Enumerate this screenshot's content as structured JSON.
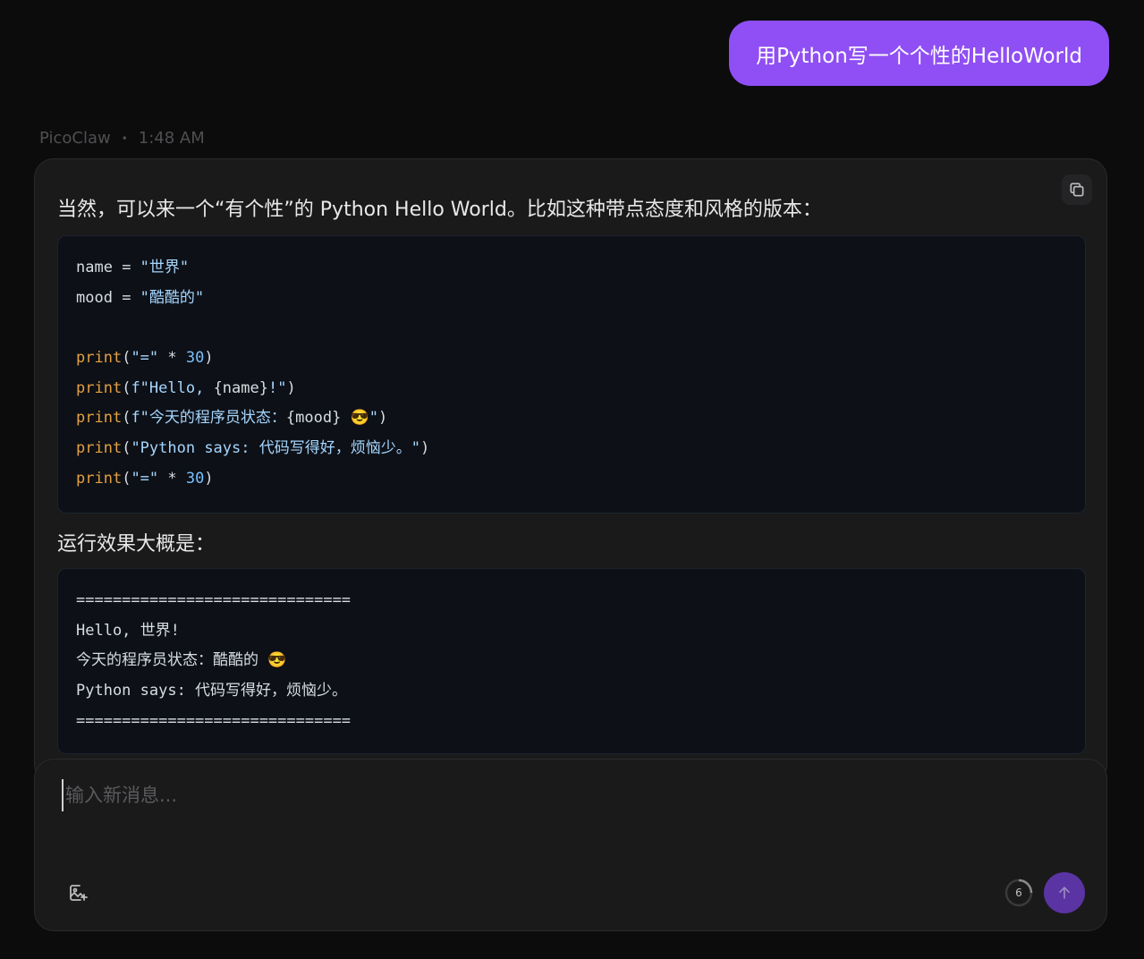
{
  "user_message": {
    "text": "用Python写一个个性的HelloWorld"
  },
  "assistant": {
    "name": "PicoClaw",
    "separator": "•",
    "time": "1:48 AM",
    "intro": "当然，可以来一个“有个性”的 Python Hello World。比如这种带点态度和风格的版本：",
    "code": {
      "l1": {
        "a": "name",
        "b": " = ",
        "c": "\"世界\""
      },
      "l2": {
        "a": "mood",
        "b": " = ",
        "c": "\"酷酷的\""
      },
      "l4": {
        "a": "print",
        "b": "(",
        "c": "\"=\"",
        "d": " * ",
        "e": "30",
        "f": ")"
      },
      "l5": {
        "a": "print",
        "b": "(",
        "c": "f\"Hello, ",
        "d": "{name}",
        "e": "!\"",
        "f": ")"
      },
      "l6": {
        "a": "print",
        "b": "(",
        "c": "f\"今天的程序员状态：",
        "d": "{mood}",
        "e": " 😎\"",
        "f": ")"
      },
      "l7": {
        "a": "print",
        "b": "(",
        "c": "\"Python says: 代码写得好，烦恼少。\"",
        "d": ")"
      },
      "l8": {
        "a": "print",
        "b": "(",
        "c": "\"=\"",
        "d": " * ",
        "e": "30",
        "f": ")"
      }
    },
    "run_label": "运行效果大概是：",
    "output": [
      "==============================",
      "Hello, 世界!",
      "今天的程序员状态：酷酷的 😎",
      "Python says: 代码写得好，烦恼少。",
      "=============================="
    ]
  },
  "composer": {
    "placeholder": "输入新消息...",
    "counter": "6"
  },
  "icons": {
    "copy": "copy-icon",
    "image": "image-add-icon",
    "send": "arrow-up-icon"
  },
  "colors": {
    "user_bubble": "#8f4ff4",
    "send_button": "#5b34a3",
    "keyword": "#e3a043",
    "string": "#a5d6ff",
    "number": "#79c0ff"
  }
}
